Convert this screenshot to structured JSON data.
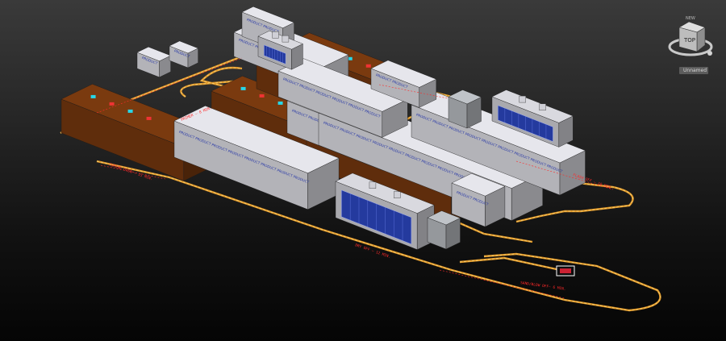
{
  "viewcube": {
    "top_label": "TOP",
    "compass_label": "NEW"
  },
  "viewport_label": "Unnamed",
  "annotations": {
    "sand_blow_off": "SAND/BLOW OFF— 6 MIN.",
    "zone_a": "CURING OVEN — 15 MIN.",
    "zone_b": "DRY OFF — 12 MIN.",
    "zone_c": "FLASH OFF — 10 MIN.",
    "zone_d": "PRIMER — 8 MIN."
  },
  "panel_text": "PRODUCT",
  "colors": {
    "oven_brown": "#7a3a0f",
    "track_outer": "#e39a2a",
    "track_inner": "#f4d37a",
    "booth_white": "#e6e6ec",
    "glass_blue": "#2a3aa8",
    "annotation_red": "#ff2a2a"
  }
}
